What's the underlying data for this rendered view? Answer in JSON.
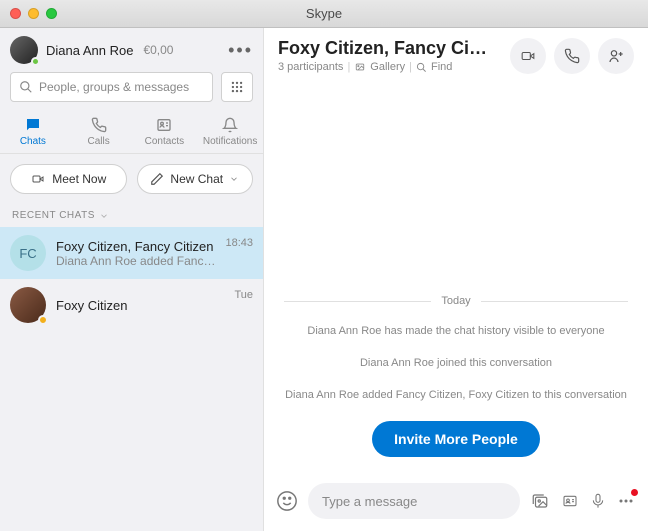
{
  "titlebar": {
    "title": "Skype"
  },
  "profile": {
    "name": "Diana Ann Roe",
    "balance": "€0,00"
  },
  "search": {
    "placeholder": "People, groups & messages"
  },
  "tabs": {
    "chats": "Chats",
    "calls": "Calls",
    "contacts": "Contacts",
    "notifications": "Notifications"
  },
  "actions": {
    "meetnow": "Meet Now",
    "newchat": "New Chat"
  },
  "section": "RECENT CHATS",
  "chats": [
    {
      "avatar_initials": "FC",
      "name": "Foxy Citizen, Fancy Citizen",
      "sub": "Diana Ann Roe added Fancy …",
      "time": "18:43"
    },
    {
      "name": "Foxy Citizen",
      "time": "Tue"
    }
  ],
  "header": {
    "title": "Foxy Citizen, Fancy Ci…",
    "participants": "3 participants",
    "gallery": "Gallery",
    "find": "Find"
  },
  "messages": {
    "day": "Today",
    "sys1": "Diana Ann Roe has made the chat history visible to everyone",
    "sys2": "Diana Ann Roe joined this conversation",
    "sys3": "Diana Ann Roe added Fancy Citizen, Foxy Citizen to this conversation",
    "invite": "Invite More People"
  },
  "input": {
    "placeholder": "Type a message"
  }
}
